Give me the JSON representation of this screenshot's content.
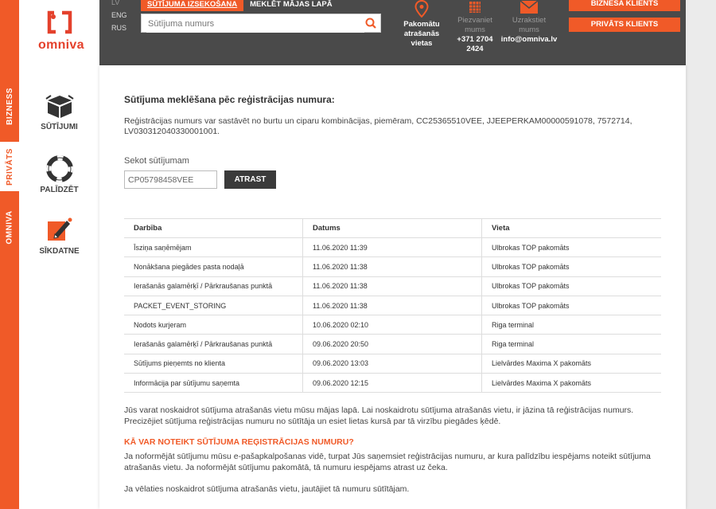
{
  "rail": {
    "biz": "BIZNESS",
    "priv": "PRIVĀTS",
    "omn": "OMNIVA"
  },
  "logo": {
    "word": "omniva"
  },
  "leftnav": [
    {
      "label": "SŪTĪJUMI",
      "icon": "parcel-box-icon"
    },
    {
      "label": "PALĪDZĒT",
      "icon": "lifebuoy-icon"
    },
    {
      "label": "SĪKDATNE",
      "icon": "cookie-edit-icon"
    }
  ],
  "header": {
    "langs": [
      "LV",
      "ENG",
      "RUS"
    ],
    "tabs": [
      "SŪTĪJUMA IZSEKOŠANA",
      "MEKLĒT MĀJAS LAPĀ"
    ],
    "search_placeholder": "Sūtījuma numurs",
    "parcel_machines": {
      "l1": "Pakomātu",
      "l2": "atrašanās",
      "l3": "vietas"
    },
    "call": {
      "l1": "Piezvaniet",
      "l2": "mums",
      "l3": "+371 2704",
      "l4": "2424"
    },
    "write": {
      "l1": "Uzrakstiet",
      "l2": "mums",
      "l3": "info@omniva.lv"
    },
    "business_btn": "BIZNESA KLIENTS",
    "private_btn": "PRIVĀTS KLIENTS"
  },
  "main": {
    "title": "Sūtījuma meklēšana pēc reģistrācijas numura:",
    "intro": "Reģistrācijas numurs var sastāvēt no burtu un ciparu kombinācijas, piemēram, CC25365510VEE, JJEEPERKAM00000591078, 7572714, LV030312040330001001.",
    "track_label": "Sekot sūtījumam",
    "track_value": "CP05798458VEE",
    "track_button": "ATRAST",
    "table": {
      "headers": [
        "Darbība",
        "Datums",
        "Vieta"
      ],
      "rows": [
        [
          "Īsziņa saņēmējam",
          "11.06.2020 11:39",
          "Ulbrokas TOP pakomāts"
        ],
        [
          "Nonākšana piegādes pasta nodaļā",
          "11.06.2020 11:38",
          "Ulbrokas TOP pakomāts"
        ],
        [
          "Ierašanās galamērķī / Pārkraušanas punktā",
          "11.06.2020 11:38",
          "Ulbrokas TOP pakomāts"
        ],
        [
          "PACKET_EVENT_STORING",
          "11.06.2020 11:38",
          "Ulbrokas TOP pakomāts"
        ],
        [
          "Nodots kurjeram",
          "10.06.2020 02:10",
          "Riga terminal"
        ],
        [
          "Ierašanās galamērķī / Pārkraušanas punktā",
          "09.06.2020 20:50",
          "Riga terminal"
        ],
        [
          "Sūtījums pieņemts no klienta",
          "09.06.2020 13:03",
          "Lielvārdes Maxima X pakomāts"
        ],
        [
          "Informācija par sūtījumu saņemta",
          "09.06.2020 12:15",
          "Lielvārdes Maxima X pakomāts"
        ]
      ]
    },
    "para1": "Jūs varat noskaidrot sūtījuma atrašanās vietu mūsu mājas lapā. Lai noskaidrotu sūtījuma atrašanās vietu, ir jāzina tā reģistrācijas numurs. Precizējiet sūtījuma reģistrācijas numuru no sūtītāja un esiet lietas kursā par tā virzību piegādes ķēdē.",
    "faq_heading": "KĀ VAR NOTEIKT SŪTĪJUMA REĢISTRĀCIJAS NUMURU?",
    "para2": "Ja noformējāt sūtījumu mūsu e-pašapkalpošanas vidē, turpat Jūs saņemsiet reģistrācijas numuru, ar kura palīdzību iespējams noteikt sūtījuma atrašanās vietu. Ja noformējāt sūtījumu pakomātā, tā numuru iespējams atrast uz čeka.",
    "para3": "Ja vēlaties noskaidrot sūtījuma atrašanās vietu, jautājiet tā numuru sūtītājam."
  },
  "colors": {
    "accent": "#f05a28",
    "header_bg": "#4a4a4a"
  }
}
